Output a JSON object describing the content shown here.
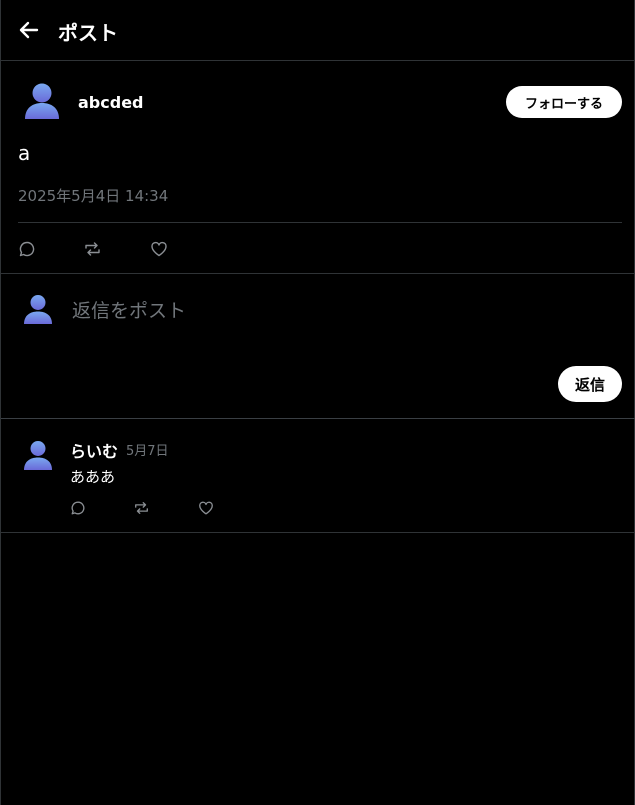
{
  "header": {
    "title": "ポスト",
    "back_icon": "arrow-left-icon"
  },
  "post": {
    "author": "abcded",
    "follow_label": "フォローする",
    "text": "a",
    "timestamp": "2025年5月4日 14:34",
    "actions": [
      "reply-icon",
      "repost-icon",
      "like-icon"
    ]
  },
  "composer": {
    "placeholder": "返信をポスト",
    "value": "",
    "submit_label": "返信"
  },
  "replies": [
    {
      "author": "らいむ",
      "date": "5月7日",
      "text": "あああ"
    }
  ],
  "colors": {
    "background": "#000000",
    "border": "#2f3336",
    "muted": "#71767b",
    "avatar_gradient": [
      "#7aa8f0",
      "#6a6ad8"
    ]
  }
}
